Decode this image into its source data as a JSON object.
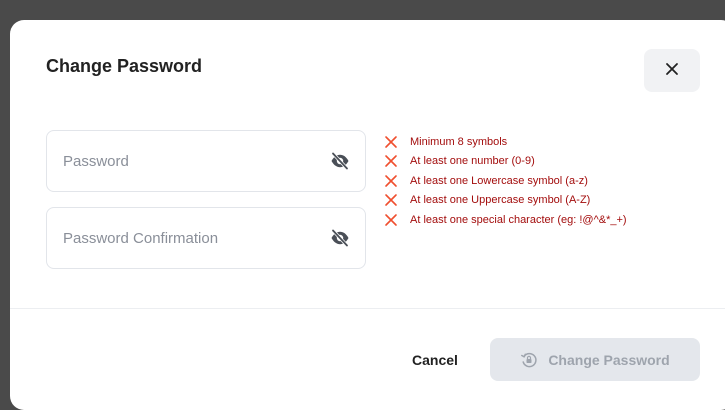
{
  "dialog": {
    "title": "Change Password",
    "close_icon": "close-icon"
  },
  "fields": {
    "password": {
      "placeholder": "Password",
      "value": "",
      "visibility_icon": "eye-off-icon"
    },
    "password_confirmation": {
      "placeholder": "Password Confirmation",
      "value": "",
      "visibility_icon": "eye-off-icon"
    }
  },
  "requirements": [
    {
      "text": "Minimum 8 symbols",
      "met": false,
      "icon": "x-icon"
    },
    {
      "text": "At least one number (0-9)",
      "met": false,
      "icon": "x-icon"
    },
    {
      "text": "At least one Lowercase symbol (a-z)",
      "met": false,
      "icon": "x-icon"
    },
    {
      "text": "At least one Uppercase symbol (A-Z)",
      "met": false,
      "icon": "x-icon"
    },
    {
      "text": "At least one special character (eg: !@^&*_+)",
      "met": false,
      "icon": "x-icon"
    }
  ],
  "footer": {
    "cancel_label": "Cancel",
    "submit_label": "Change Password",
    "submit_icon": "lock-reset-icon",
    "submit_disabled": true
  },
  "colors": {
    "backdrop": "#4a4a4a",
    "error_text": "#a30d0d",
    "error_icon": "#f04f2f",
    "disabled_button_bg": "#e4e7ec",
    "disabled_button_text": "#9ea4ad"
  }
}
